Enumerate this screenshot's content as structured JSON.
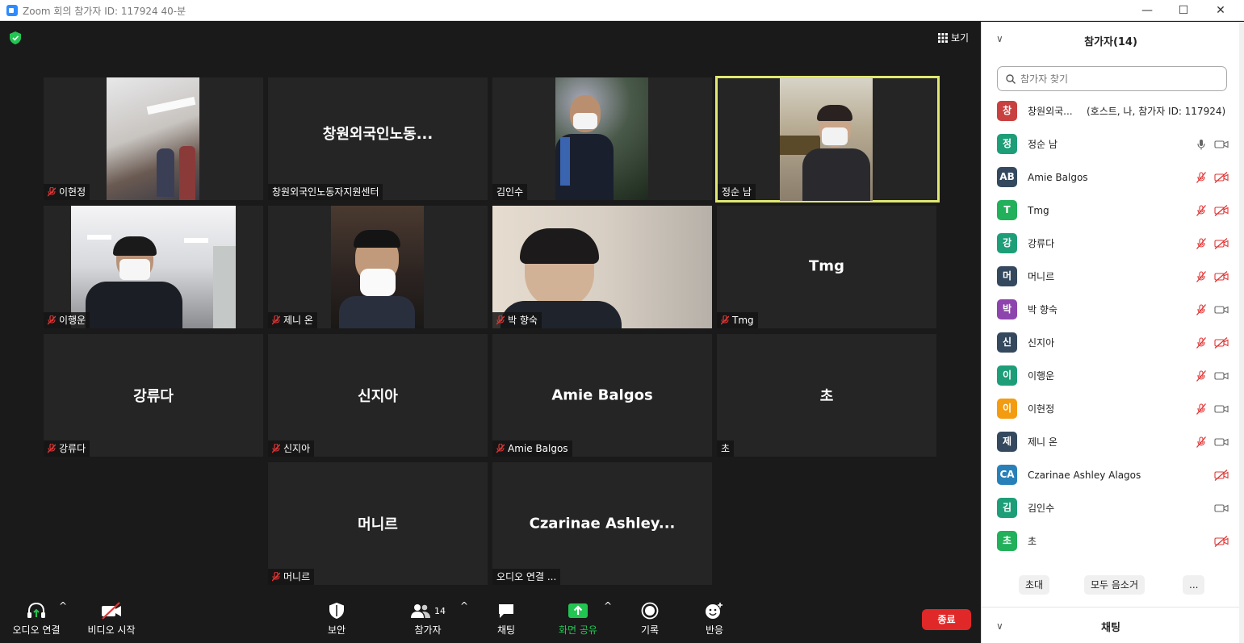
{
  "window": {
    "title": "Zoom 회의 참가자 ID: 117924   40-분",
    "minimize": "—",
    "maximize": "☐",
    "close": "✕"
  },
  "main": {
    "view_label": "보기",
    "tiles": [
      {
        "big": "",
        "label": "이현정",
        "muted": true
      },
      {
        "big": "창원외국인노동...",
        "label": "창원외국인노동자지원센터",
        "muted": false
      },
      {
        "big": "",
        "label": "김인수",
        "muted": false
      },
      {
        "big": "",
        "label": "정순 남",
        "muted": false
      },
      {
        "big": "",
        "label": "이행운",
        "muted": true
      },
      {
        "big": "",
        "label": "제니 온",
        "muted": true
      },
      {
        "big": "",
        "label": "박 향숙",
        "muted": true
      },
      {
        "big": "Tmg",
        "label": "Tmg",
        "muted": true
      },
      {
        "big": "강류다",
        "label": "강류다",
        "muted": true
      },
      {
        "big": "신지아",
        "label": "신지아",
        "muted": true
      },
      {
        "big": "Amie Balgos",
        "label": "Amie Balgos",
        "muted": true
      },
      {
        "big": "초",
        "label": "초",
        "muted": false
      },
      {
        "big": "머니르",
        "label": "머니르",
        "muted": true
      },
      {
        "big": "Czarinae  Ashley...",
        "label": "오디오 연결 ...",
        "muted": false
      }
    ]
  },
  "toolbar": {
    "audio": "오디오 연결",
    "video": "비디오 시작",
    "security": "보안",
    "participants": "참가자",
    "participants_count": "14",
    "chat": "채팅",
    "share": "화면 공유",
    "record": "기록",
    "reactions": "반응",
    "end": "종료",
    "caret": "^"
  },
  "panel": {
    "title": "참가자(14)",
    "collapse": "∨",
    "search_placeholder": "참가자 찾기",
    "participants": [
      {
        "initial": "창",
        "name": "창원외국...",
        "extra": "(호스트, 나, 참가자 ID: 117924)",
        "color": "#c94040",
        "mic": "none",
        "cam": "none"
      },
      {
        "initial": "정",
        "name": "정순 남",
        "extra": "",
        "color": "#1e9e78",
        "mic": "on",
        "cam": "on"
      },
      {
        "initial": "AB",
        "name": "Amie Balgos",
        "extra": "",
        "color": "#34495e",
        "mic": "off",
        "cam": "off"
      },
      {
        "initial": "T",
        "name": "Tmg",
        "extra": "",
        "color": "#22b05a",
        "mic": "off",
        "cam": "off"
      },
      {
        "initial": "강",
        "name": "강류다",
        "extra": "",
        "color": "#1e9e78",
        "mic": "off",
        "cam": "off"
      },
      {
        "initial": "머",
        "name": "머니르",
        "extra": "",
        "color": "#34495e",
        "mic": "off",
        "cam": "off"
      },
      {
        "initial": "박",
        "name": "박 향숙",
        "extra": "",
        "color": "#8e44ad",
        "mic": "off",
        "cam": "on"
      },
      {
        "initial": "신",
        "name": "신지아",
        "extra": "",
        "color": "#34495e",
        "mic": "off",
        "cam": "off"
      },
      {
        "initial": "이",
        "name": "이행운",
        "extra": "",
        "color": "#1e9e78",
        "mic": "off",
        "cam": "on"
      },
      {
        "initial": "이",
        "name": "이현정",
        "extra": "",
        "color": "#f39c12",
        "mic": "off",
        "cam": "on"
      },
      {
        "initial": "제",
        "name": "제니 온",
        "extra": "",
        "color": "#34495e",
        "mic": "off",
        "cam": "on"
      },
      {
        "initial": "CA",
        "name": "Czarinae Ashley Alagos",
        "extra": "",
        "color": "#2980b9",
        "mic": "none",
        "cam": "off"
      },
      {
        "initial": "김",
        "name": "김인수",
        "extra": "",
        "color": "#1e9e78",
        "mic": "none",
        "cam": "on"
      },
      {
        "initial": "초",
        "name": "초",
        "extra": "",
        "color": "#22b05a",
        "mic": "none",
        "cam": "off"
      }
    ],
    "invite": "초대",
    "mute_all": "모두 음소거",
    "more": "...",
    "chat_title": "채팅"
  }
}
